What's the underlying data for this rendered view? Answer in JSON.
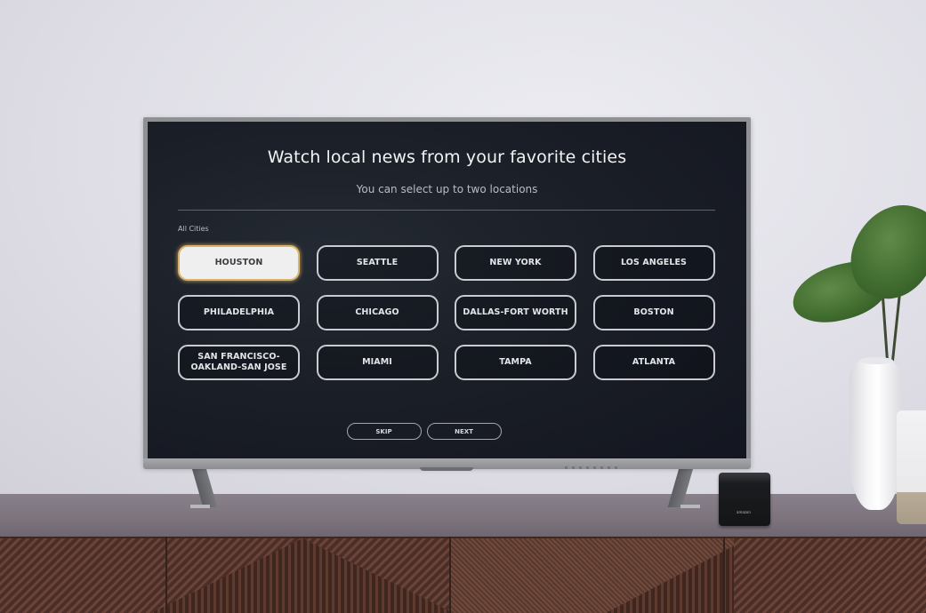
{
  "screen": {
    "title": "Watch local news from your favorite cities",
    "subtitle": "You can select up to two locations",
    "section_label": "All Cities",
    "cities": [
      {
        "label": "HOUSTON",
        "focused": true
      },
      {
        "label": "SEATTLE",
        "focused": false
      },
      {
        "label": "NEW YORK",
        "focused": false
      },
      {
        "label": "LOS ANGELES",
        "focused": false
      },
      {
        "label": "PHILADELPHIA",
        "focused": false
      },
      {
        "label": "CHICAGO",
        "focused": false
      },
      {
        "label": "DALLAS-FORT WORTH",
        "focused": false
      },
      {
        "label": "BOSTON",
        "focused": false
      },
      {
        "label": "SAN FRANCISCO-\nOAKLAND-SAN JOSE",
        "focused": false
      },
      {
        "label": "MIAMI",
        "focused": false
      },
      {
        "label": "TAMPA",
        "focused": false
      },
      {
        "label": "ATLANTA",
        "focused": false
      }
    ],
    "actions": {
      "skip_label": "SKIP",
      "next_label": "NEXT"
    }
  },
  "device": {
    "cube_label": "amazon"
  },
  "colors": {
    "focus_ring": "#d9b46a",
    "screen_bg": "#1b1f27",
    "button_border": "#c9cbd0"
  }
}
